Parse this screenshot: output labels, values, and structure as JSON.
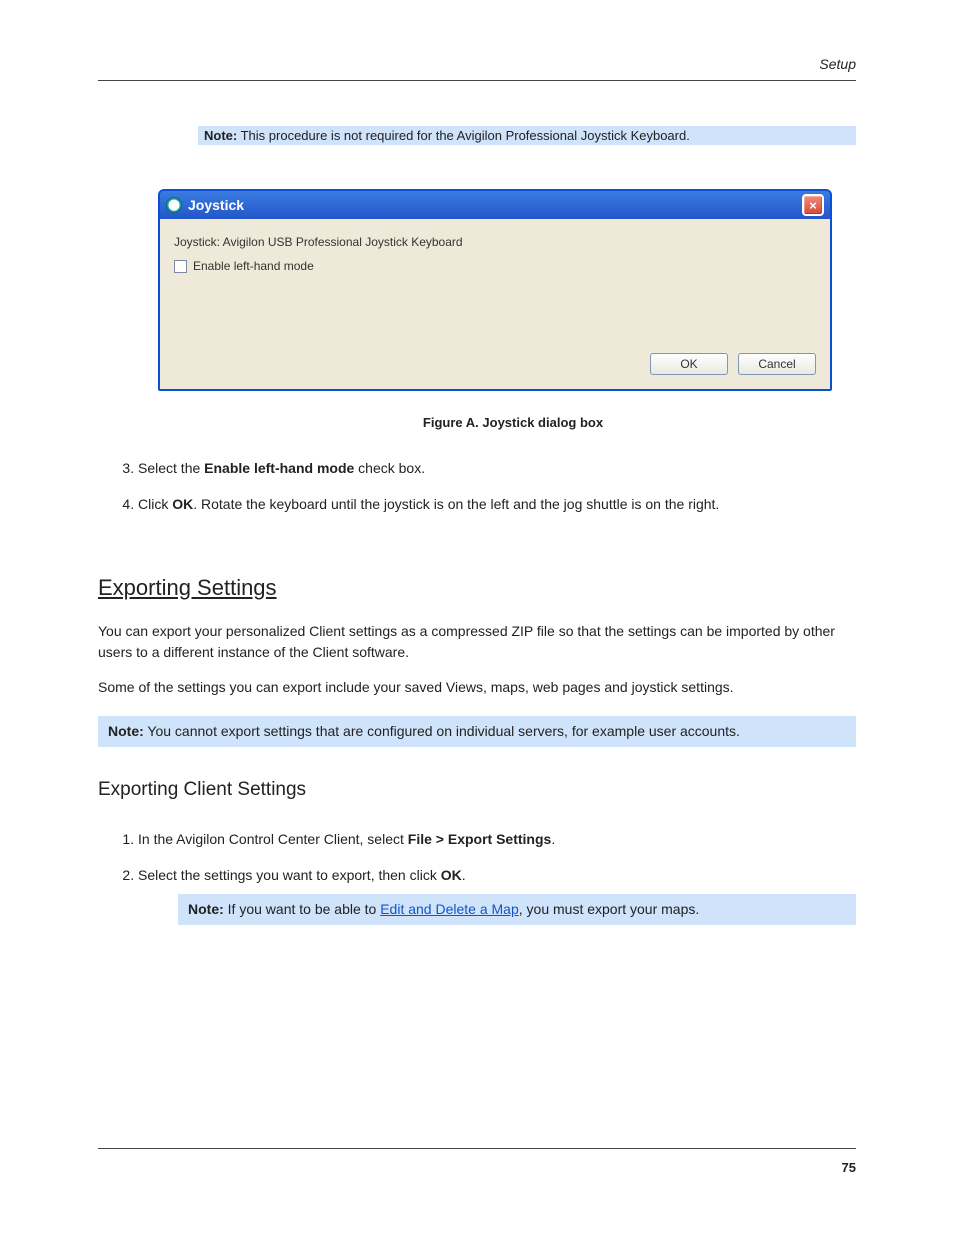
{
  "header": {
    "section_title": "Setup"
  },
  "note1": {
    "label": "Note:",
    "text": "This procedure is not required for the Avigilon Professional Joystick Keyboard."
  },
  "dialog": {
    "title": "Joystick",
    "body_text": "Joystick: Avigilon USB Professional Joystick Keyboard",
    "checkbox_label": "Enable left-hand mode",
    "ok_label": "OK",
    "cancel_label": "Cancel",
    "close_label": "×"
  },
  "figure": {
    "label": "Figure A.",
    "caption": "Joystick dialog box"
  },
  "steps_a": [
    "Select the Enable left-hand mode check box.",
    "Click OK. Rotate the keyboard until the joystick is on the left and the jog shuttle is on the right."
  ],
  "h2": "Exporting Settings",
  "exporting_intro_1": "You can export your personalized Client settings as a compressed ZIP file so that the settings can be imported by other users to a different instance of the Client software.",
  "exporting_intro_2": "Some of the settings you can export include your saved Views, maps, web pages and joystick settings.",
  "note2": {
    "label": "Note:",
    "text": "You cannot export settings that are configured on individual servers, for example user accounts."
  },
  "h3": "Exporting Client Settings",
  "steps_b_1": "In the Avigilon Control Center Client, select ",
  "steps_b_1b": "File > Export Settings",
  "steps_b_1c": ".",
  "steps_b_2a": "Select the settings you want to export, then click ",
  "steps_b_2b": "OK",
  "steps_b_2c": ".",
  "inner_note": {
    "label": "Note:",
    "text": "If you want to be able to ",
    "link": "Edit and Delete a Map",
    "text2": ", you must export your maps."
  },
  "page_number": "75",
  "semantic": {
    "bold_ok": "OK",
    "bold_enable": "Enable left-hand mode"
  }
}
